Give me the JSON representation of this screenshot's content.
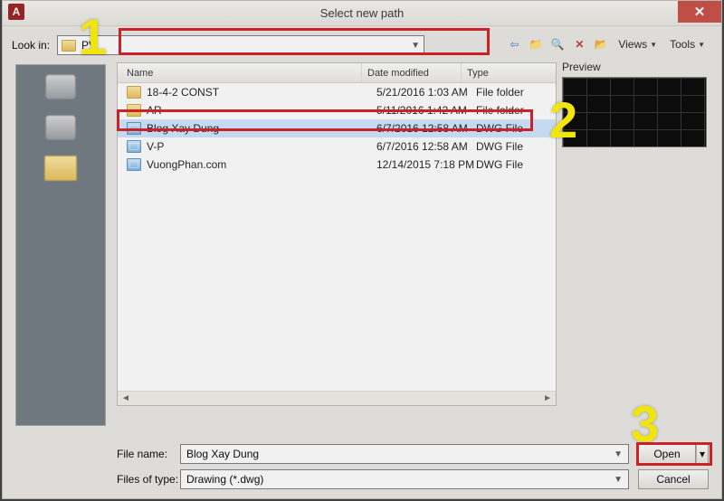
{
  "window": {
    "title": "Select new path",
    "app_logo_letter": "A",
    "close_glyph": "✕"
  },
  "lookin": {
    "label": "Look in:",
    "value": "PV"
  },
  "toolbar": {
    "views_label": "Views",
    "tools_label": "Tools"
  },
  "sidebar": {
    "items": [
      {
        "label": ""
      },
      {
        "label": ""
      },
      {
        "label": ""
      }
    ]
  },
  "filelist": {
    "headers": {
      "name": "Name",
      "date": "Date modified",
      "type": "Type"
    },
    "rows": [
      {
        "icon": "folder",
        "name": "18-4-2 CONST",
        "date": "5/21/2016 1:03 AM",
        "type": "File folder",
        "selected": false
      },
      {
        "icon": "folder",
        "name": "AR",
        "date": "5/11/2016 1:42 AM",
        "type": "File folder",
        "selected": false
      },
      {
        "icon": "dwg",
        "name": "Blog Xay Dung",
        "date": "6/7/2016 12:58 AM",
        "type": "DWG File",
        "selected": true
      },
      {
        "icon": "dwg",
        "name": "V-P",
        "date": "6/7/2016 12:58 AM",
        "type": "DWG File",
        "selected": false
      },
      {
        "icon": "dwg",
        "name": "VuongPhan.com",
        "date": "12/14/2015 7:18 PM",
        "type": "DWG File",
        "selected": false
      }
    ],
    "scroll_left_glyph": "◄",
    "scroll_right_glyph": "►"
  },
  "preview": {
    "label": "Preview"
  },
  "bottom": {
    "filename_label": "File name:",
    "filename_value": "Blog Xay Dung",
    "filetype_label": "Files of type:",
    "filetype_value": "Drawing (*.dwg)",
    "open_label": "Open",
    "cancel_label": "Cancel",
    "split_glyph": "▾"
  },
  "annotations": {
    "n1": "1",
    "n2": "2",
    "n3": "3"
  },
  "colors": {
    "highlight_border": "#d4191e",
    "callout_text": "#fff200"
  }
}
